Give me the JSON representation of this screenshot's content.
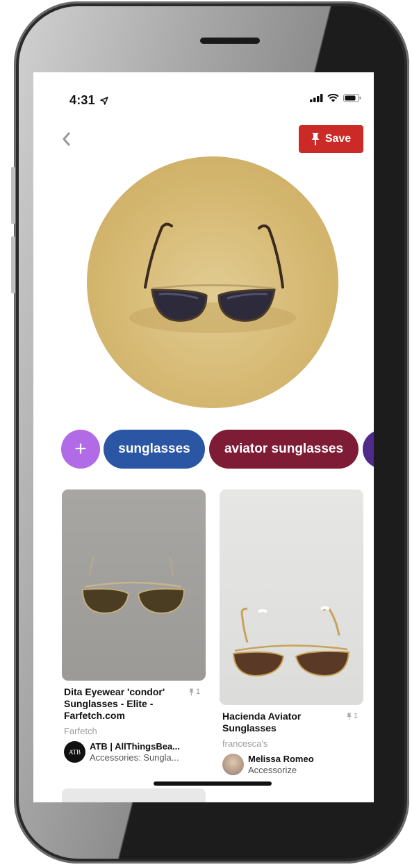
{
  "status_bar": {
    "time": "4:31"
  },
  "header": {
    "save_label": "Save"
  },
  "chips": {
    "add_symbol": "+",
    "items": [
      "sunglasses",
      "aviator sunglasses"
    ]
  },
  "pins": [
    {
      "title": "Dita Eyewear 'condor' Sunglasses - Elite - Farfetch.com",
      "title_lines": [
        "Dita Eyewear 'condor'",
        "Sunglasses - Elite -",
        "Farfetch.com"
      ],
      "save_count": "1",
      "source": "Farfetch",
      "user": "ATB | AllThingsBea...",
      "board": "Accessories: Sungla...",
      "avatar_text": "ATB"
    },
    {
      "title": "Hacienda Aviator Sunglasses",
      "title_lines": [
        "Hacienda Aviator",
        "Sunglasses"
      ],
      "save_count": "1",
      "source": "francesca's",
      "user": "Melissa Romeo",
      "board": "Accessorize"
    }
  ],
  "colors": {
    "save_red": "#cb2a27",
    "chip_add": "#b26be6",
    "chip_sunglasses": "#2a56a4",
    "chip_aviator": "#7e1b35",
    "chip_next": "#4e2a8c",
    "hero_gold": "#d5b871"
  },
  "icons": [
    "location-arrow-icon",
    "signal-icon",
    "wifi-icon",
    "battery-icon",
    "back-chevron-icon",
    "pin-icon"
  ]
}
